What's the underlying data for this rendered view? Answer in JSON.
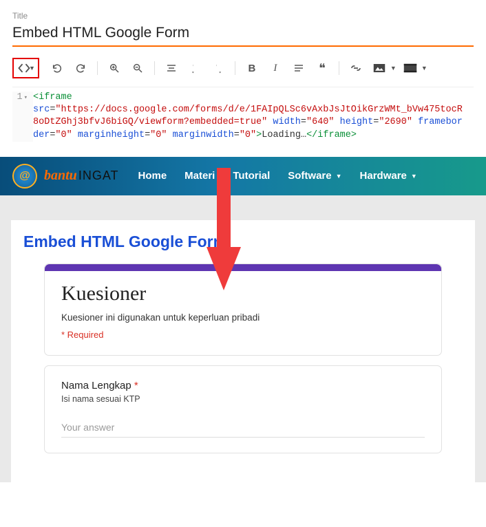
{
  "editor": {
    "title_label": "Title",
    "title_value": "Embed HTML Google Form",
    "line_number": "1",
    "code": {
      "tag_open": "<iframe",
      "attr_src_name": "src",
      "attr_src_val": "\"https://docs.google.com/forms/d/e/1FAIpQLSc6vAxbJsJtOikGrzWMt_bVw475tocR8oDtZGhj3bfvJ6biGQ/viewform?embedded=true\"",
      "attr_width_name": "width",
      "attr_width_val": "\"640\"",
      "attr_height_name": "height",
      "attr_height_val": "\"2690\"",
      "attr_fb_name": "frameborder",
      "attr_fb_val": "\"0\"",
      "attr_mh_name": "marginheight",
      "attr_mh_val": "\"0\"",
      "attr_mw_name": "marginwidth",
      "attr_mw_val": "\"0\"",
      "tag_close_open": ">",
      "inner_text": "Loading…",
      "tag_close": "</iframe>"
    }
  },
  "site": {
    "brand1": "bantu",
    "brand2": "INGAT",
    "nav": {
      "home": "Home",
      "materi": "Materi",
      "tutorial": "Tutorial",
      "software": "Software",
      "hardware": "Hardware"
    },
    "page_heading": "Embed HTML Google Form",
    "form": {
      "title": "Kuesioner",
      "desc": "Kuesioner ini digunakan untuk keperluan pribadi",
      "required_note": "* Required",
      "q1_label": "Nama Lengkap",
      "q1_ast": "*",
      "q1_hint": "Isi nama sesuai KTP",
      "q1_placeholder": "Your answer"
    }
  }
}
